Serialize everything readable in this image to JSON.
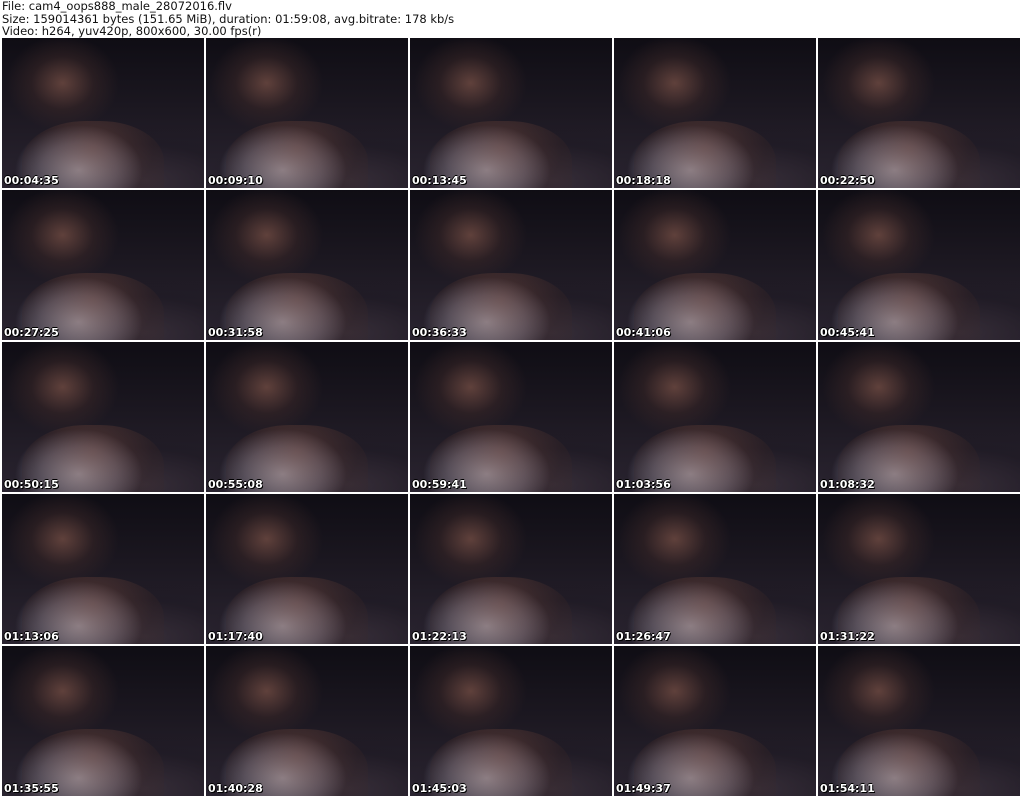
{
  "header": {
    "file_line": "File: cam4_oops888_male_28072016.flv",
    "size_line": "Size: 159014361 bytes (151.65 MiB), duration: 01:59:08, avg.bitrate: 178 kb/s",
    "video_line": "Video: h264, yuv420p, 800x600, 30.00 fps(r)"
  },
  "thumbnails": [
    "00:04:35",
    "00:09:10",
    "00:13:45",
    "00:18:18",
    "00:22:50",
    "00:27:25",
    "00:31:58",
    "00:36:33",
    "00:41:06",
    "00:45:41",
    "00:50:15",
    "00:55:08",
    "00:59:41",
    "01:03:56",
    "01:08:32",
    "01:13:06",
    "01:17:40",
    "01:22:13",
    "01:26:47",
    "01:31:22",
    "01:35:55",
    "01:40:28",
    "01:45:03",
    "01:49:37",
    "01:54:11"
  ]
}
